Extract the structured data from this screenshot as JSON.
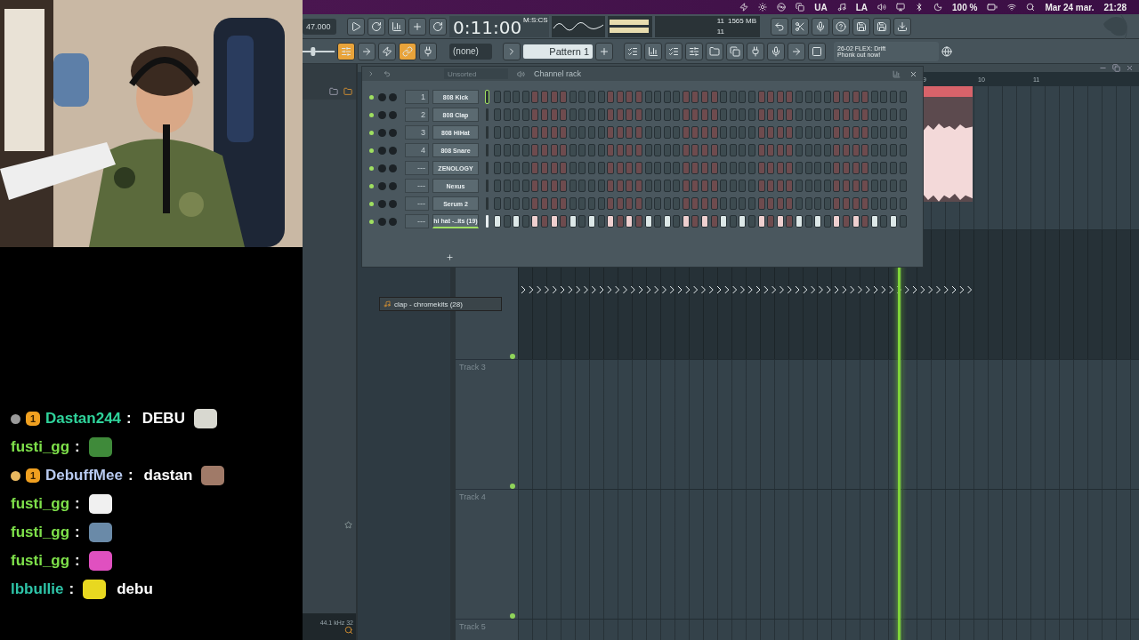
{
  "menu_bar": {
    "ua": "UA",
    "la": "LA",
    "battery": "100 %",
    "date": "Mar 24 mar.",
    "time": "21:28"
  },
  "master_volume": {
    "level": 0.3
  },
  "toolbar": {
    "tempo": "47.000",
    "time": "0:11:00",
    "time_format": "M:S:CS",
    "cpu": "11",
    "memory": "1565 MB",
    "polyphony": "11",
    "pattern_picker": "(none)",
    "pattern": "Pattern 1",
    "hint_title": "26-02  FLEX: Drift",
    "hint_text": "Phonk out now!"
  },
  "browser": {
    "footer": "44.1 kHz 32"
  },
  "channel_rack": {
    "title": "Channel rack",
    "filter": "Unsorted",
    "channels": [
      {
        "number": "1",
        "name": "808 Kick",
        "focused": true,
        "selected": false,
        "steps": [
          false,
          false,
          false,
          false,
          false,
          false,
          false,
          false,
          false,
          false,
          false,
          false,
          false,
          false,
          false,
          false,
          false,
          false,
          false,
          false,
          false,
          false,
          false,
          false,
          false,
          false,
          false,
          false,
          false,
          false,
          false,
          false,
          false,
          false,
          false,
          false,
          false,
          false,
          false,
          false,
          false,
          false,
          false,
          false
        ]
      },
      {
        "number": "2",
        "name": "808 Clap",
        "focused": false,
        "selected": false,
        "steps": [
          false,
          false,
          false,
          false,
          false,
          false,
          false,
          false,
          false,
          false,
          false,
          false,
          false,
          false,
          false,
          false,
          false,
          false,
          false,
          false,
          false,
          false,
          false,
          false,
          false,
          false,
          false,
          false,
          false,
          false,
          false,
          false,
          false,
          false,
          false,
          false,
          false,
          false,
          false,
          false,
          false,
          false,
          false,
          false
        ]
      },
      {
        "number": "3",
        "name": "808 HiHat",
        "focused": false,
        "selected": false,
        "steps": [
          false,
          false,
          false,
          false,
          false,
          false,
          false,
          false,
          false,
          false,
          false,
          false,
          false,
          false,
          false,
          false,
          false,
          false,
          false,
          false,
          false,
          false,
          false,
          false,
          false,
          false,
          false,
          false,
          false,
          false,
          false,
          false,
          false,
          false,
          false,
          false,
          false,
          false,
          false,
          false,
          false,
          false,
          false,
          false
        ]
      },
      {
        "number": "4",
        "name": "808 Snare",
        "focused": false,
        "selected": false,
        "steps": [
          false,
          false,
          false,
          false,
          false,
          false,
          false,
          false,
          false,
          false,
          false,
          false,
          false,
          false,
          false,
          false,
          false,
          false,
          false,
          false,
          false,
          false,
          false,
          false,
          false,
          false,
          false,
          false,
          false,
          false,
          false,
          false,
          false,
          false,
          false,
          false,
          false,
          false,
          false,
          false,
          false,
          false,
          false,
          false
        ]
      },
      {
        "number": "---",
        "name": "ZENOLOGY",
        "focused": false,
        "selected": false,
        "steps": [
          false,
          false,
          false,
          false,
          false,
          false,
          false,
          false,
          false,
          false,
          false,
          false,
          false,
          false,
          false,
          false,
          false,
          false,
          false,
          false,
          false,
          false,
          false,
          false,
          false,
          false,
          false,
          false,
          false,
          false,
          false,
          false,
          false,
          false,
          false,
          false,
          false,
          false,
          false,
          false,
          false,
          false,
          false,
          false
        ]
      },
      {
        "number": "---",
        "name": "Nexus",
        "focused": false,
        "selected": false,
        "steps": [
          false,
          false,
          false,
          false,
          false,
          false,
          false,
          false,
          false,
          false,
          false,
          false,
          false,
          false,
          false,
          false,
          false,
          false,
          false,
          false,
          false,
          false,
          false,
          false,
          false,
          false,
          false,
          false,
          false,
          false,
          false,
          false,
          false,
          false,
          false,
          false,
          false,
          false,
          false,
          false,
          false,
          false,
          false,
          false
        ]
      },
      {
        "number": "---",
        "name": "Serum 2",
        "focused": false,
        "selected": false,
        "steps": [
          false,
          false,
          false,
          false,
          false,
          false,
          false,
          false,
          false,
          false,
          false,
          false,
          false,
          false,
          false,
          false,
          false,
          false,
          false,
          false,
          false,
          false,
          false,
          false,
          false,
          false,
          false,
          false,
          false,
          false,
          false,
          false,
          false,
          false,
          false,
          false,
          false,
          false,
          false,
          false,
          false,
          false,
          false,
          false
        ]
      },
      {
        "number": "---",
        "name": "hi hat -..its (19)",
        "focused": false,
        "selected": true,
        "steps": [
          true,
          false,
          true,
          false,
          true,
          false,
          true,
          false,
          true,
          false,
          true,
          false,
          true,
          false,
          true,
          false,
          true,
          false,
          true,
          false,
          true,
          false,
          true,
          false,
          true,
          false,
          true,
          false,
          true,
          false,
          true,
          false,
          true,
          false,
          true,
          false,
          true,
          false,
          true,
          false,
          true,
          false,
          true,
          false
        ]
      }
    ]
  },
  "playlist": {
    "ruler": [
      "9",
      "10",
      "11"
    ],
    "tracks": [
      {
        "name": "Track 3"
      },
      {
        "name": "Track 4"
      },
      {
        "name": "Track 5"
      }
    ]
  },
  "dragged_item": {
    "label": "clap - chromekits (28)"
  },
  "chat": [
    {
      "user": "Dastan244",
      "color": "#2fd39b",
      "separator": ":",
      "badges": [
        {
          "kind": "dot",
          "color": "#9a9a9a"
        },
        {
          "kind": "sub",
          "text": "1"
        }
      ],
      "parts": [
        {
          "kind": "text",
          "text": "DEBU"
        },
        {
          "kind": "emote",
          "color": "#d8d8d0"
        }
      ]
    },
    {
      "user": "fusti_gg",
      "color": "#7ee04a",
      "separator": ":",
      "parts": [
        {
          "kind": "emote",
          "color": "#3f8a3a"
        }
      ]
    },
    {
      "user": "DebuffMee",
      "color": "#b7c9ef",
      "separator": ":",
      "badges": [
        {
          "kind": "dot",
          "color": "#e8b860"
        },
        {
          "kind": "sub",
          "text": "1"
        }
      ],
      "parts": [
        {
          "kind": "text",
          "text": "dastan"
        },
        {
          "kind": "emote",
          "color": "#a07a68"
        }
      ]
    },
    {
      "user": "fusti_gg",
      "color": "#7ee04a",
      "separator": ":",
      "parts": [
        {
          "kind": "emote",
          "color": "#f0f0f0"
        }
      ]
    },
    {
      "user": "fusti_gg",
      "color": "#7ee04a",
      "separator": ":",
      "parts": [
        {
          "kind": "emote",
          "color": "#6a8aa8"
        }
      ]
    },
    {
      "user": "fusti_gg",
      "color": "#7ee04a",
      "separator": ":",
      "parts": [
        {
          "kind": "emote",
          "color": "#e050c0"
        }
      ]
    },
    {
      "user": "lbbullie",
      "color": "#2ec4a8",
      "separator": ":",
      "parts": [
        {
          "kind": "emote",
          "color": "#e8d820"
        },
        {
          "kind": "text",
          "text": "debu"
        }
      ]
    }
  ]
}
